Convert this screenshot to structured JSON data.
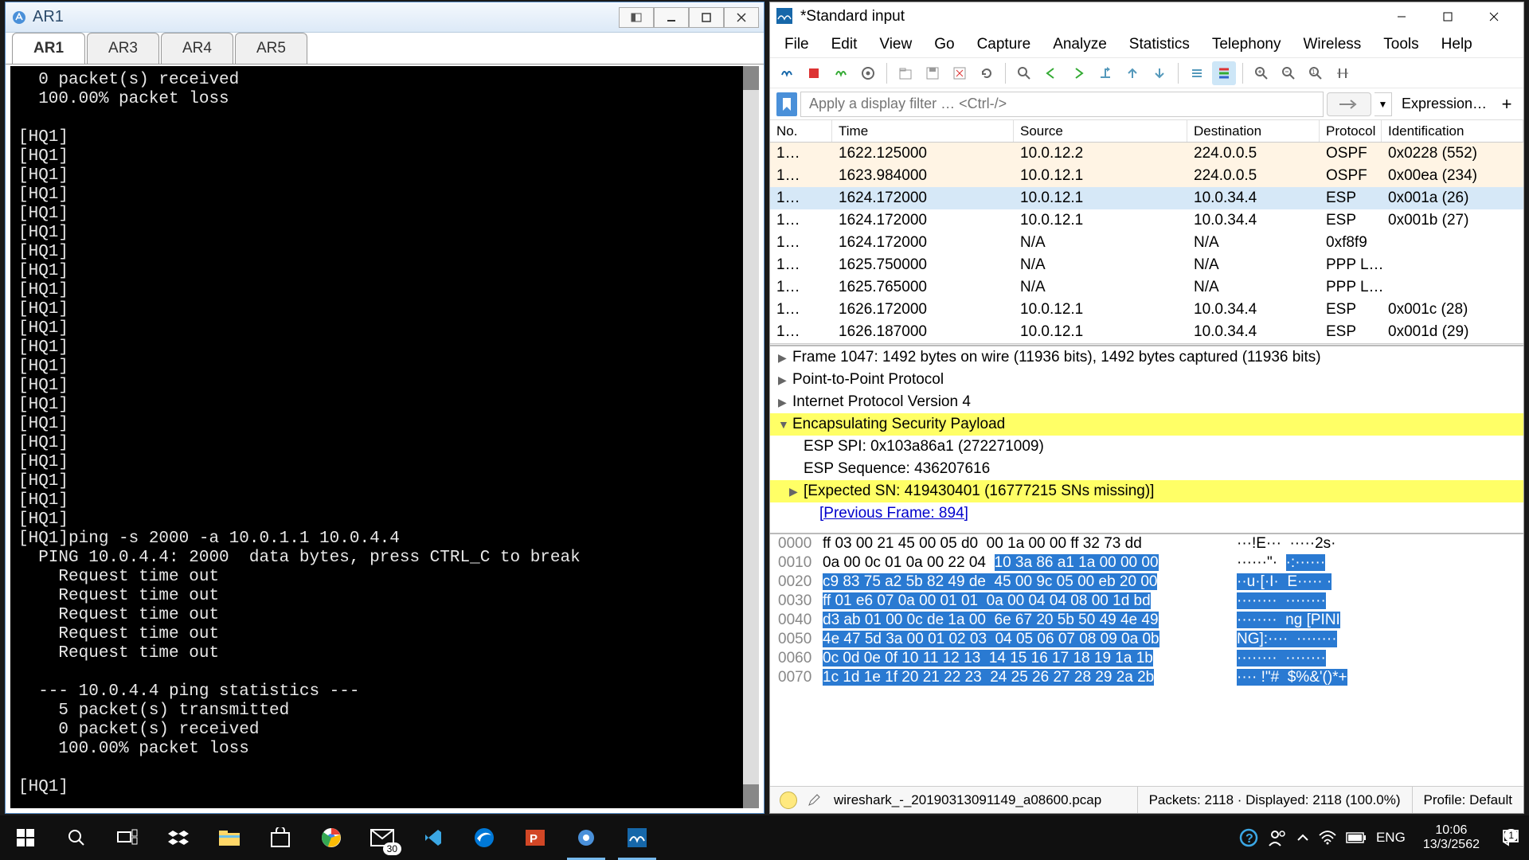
{
  "ar": {
    "title": "AR1",
    "tabs": [
      "AR1",
      "AR3",
      "AR4",
      "AR5"
    ],
    "active_tab": 0,
    "terminal_lines": [
      "  0 packet(s) received",
      "  100.00% packet loss",
      "",
      "[HQ1]",
      "[HQ1]",
      "[HQ1]",
      "[HQ1]",
      "[HQ1]",
      "[HQ1]",
      "[HQ1]",
      "[HQ1]",
      "[HQ1]",
      "[HQ1]",
      "[HQ1]",
      "[HQ1]",
      "[HQ1]",
      "[HQ1]",
      "[HQ1]",
      "[HQ1]",
      "[HQ1]",
      "[HQ1]",
      "[HQ1]",
      "[HQ1]",
      "[HQ1]",
      "[HQ1]ping -s 2000 -a 10.0.1.1 10.0.4.4",
      "  PING 10.0.4.4: 2000  data bytes, press CTRL_C to break",
      "    Request time out",
      "    Request time out",
      "    Request time out",
      "    Request time out",
      "    Request time out",
      "",
      "  --- 10.0.4.4 ping statistics ---",
      "    5 packet(s) transmitted",
      "    0 packet(s) received",
      "    100.00% packet loss",
      "",
      "[HQ1]"
    ]
  },
  "ws": {
    "title": "*Standard input",
    "menu": [
      "File",
      "Edit",
      "View",
      "Go",
      "Capture",
      "Analyze",
      "Statistics",
      "Telephony",
      "Wireless",
      "Tools",
      "Help"
    ],
    "filter_placeholder": "Apply a display filter … <Ctrl-/>",
    "expression_label": "Expression…",
    "columns": [
      "No.",
      "Time",
      "Source",
      "Destination",
      "Protocol",
      "Identification"
    ],
    "rows": [
      {
        "no": "1…",
        "time": "1622.125000",
        "src": "10.0.12.2",
        "dst": "224.0.0.5",
        "proto": "OSPF",
        "id": "0x0228 (552)",
        "bg": "#fff4e4"
      },
      {
        "no": "1…",
        "time": "1623.984000",
        "src": "10.0.12.1",
        "dst": "224.0.0.5",
        "proto": "OSPF",
        "id": "0x00ea (234)",
        "bg": "#fff4e4"
      },
      {
        "no": "1…",
        "time": "1624.172000",
        "src": "10.0.12.1",
        "dst": "10.0.34.4",
        "proto": "ESP",
        "id": "0x001a (26)",
        "bg": "#d6e8f7",
        "sel": true
      },
      {
        "no": "1…",
        "time": "1624.172000",
        "src": "10.0.12.1",
        "dst": "10.0.34.4",
        "proto": "ESP",
        "id": "0x001b (27)",
        "bg": "#ffffff"
      },
      {
        "no": "1…",
        "time": "1624.172000",
        "src": "N/A",
        "dst": "N/A",
        "proto": "0xf8f9",
        "id": "",
        "bg": "#ffffff"
      },
      {
        "no": "1…",
        "time": "1625.750000",
        "src": "N/A",
        "dst": "N/A",
        "proto": "PPP L…",
        "id": "",
        "bg": "#ffffff"
      },
      {
        "no": "1…",
        "time": "1625.765000",
        "src": "N/A",
        "dst": "N/A",
        "proto": "PPP L…",
        "id": "",
        "bg": "#ffffff"
      },
      {
        "no": "1…",
        "time": "1626.172000",
        "src": "10.0.12.1",
        "dst": "10.0.34.4",
        "proto": "ESP",
        "id": "0x001c (28)",
        "bg": "#ffffff"
      },
      {
        "no": "1…",
        "time": "1626.187000",
        "src": "10.0.12.1",
        "dst": "10.0.34.4",
        "proto": "ESP",
        "id": "0x001d (29)",
        "bg": "#ffffff"
      }
    ],
    "details": {
      "frame": "Frame 1047: 1492 bytes on wire (11936 bits), 1492 bytes captured (11936 bits)",
      "ppp": "Point-to-Point Protocol",
      "ipv4": "Internet Protocol Version 4",
      "esp": "Encapsulating Security Payload",
      "esp_spi": "ESP SPI: 0x103a86a1 (272271009)",
      "esp_seq": "ESP Sequence: 436207616",
      "esp_expected": "[Expected SN: 419430401 (16777215 SNs missing)]",
      "prev_frame": "[Previous Frame: 894]"
    },
    "hex": [
      {
        "off": "0000",
        "b1": "ff 03 00 21 45 00 05 d0  ",
        "b2": "00 1a 00 00 ff 32 73 dd",
        "a1": "···!E···  ·····2s·",
        "sel": false
      },
      {
        "off": "0010",
        "b1": "0a 00 0c 01 0a 00 22 04  ",
        "b2": "10 3a 86 a1 1a 00 00 00",
        "a1": "······\"·  ·:······",
        "sel2": true
      },
      {
        "off": "0020",
        "b1": "c9 83 75 a2 5b 82 49 de  ",
        "b2": "45 00 9c 05 00 eb 20 00",
        "a1": "··u·[·I·  E····· ·",
        "sel": true
      },
      {
        "off": "0030",
        "b1": "ff 01 e6 07 0a 00 01 01  ",
        "b2": "0a 00 04 04 08 00 1d bd",
        "a1": "········  ········",
        "sel": true
      },
      {
        "off": "0040",
        "b1": "d3 ab 01 00 0c de 1a 00  ",
        "b2": "6e 67 20 5b 50 49 4e 49",
        "a1": "········  ng [PINI",
        "sel": true
      },
      {
        "off": "0050",
        "b1": "4e 47 5d 3a 00 01 02 03  ",
        "b2": "04 05 06 07 08 09 0a 0b",
        "a1": "NG]:····  ········",
        "sel": true
      },
      {
        "off": "0060",
        "b1": "0c 0d 0e 0f 10 11 12 13  ",
        "b2": "14 15 16 17 18 19 1a 1b",
        "a1": "········  ········",
        "sel": true
      },
      {
        "off": "0070",
        "b1": "1c 1d 1e 1f 20 21 22 23  ",
        "b2": "24 25 26 27 28 29 2a 2b",
        "a1": "···· !\"#  $%&'()*+",
        "sel": true
      }
    ],
    "status": {
      "file": "wireshark_-_20190313091149_a08600.pcap",
      "packets": "Packets: 2118 · Displayed: 2118 (100.0%)",
      "profile": "Profile: Default"
    }
  },
  "tb": {
    "lang": "ENG",
    "time": "10:06",
    "date": "13/3/2562",
    "mail_badge": "30",
    "notif_badge": "1"
  }
}
